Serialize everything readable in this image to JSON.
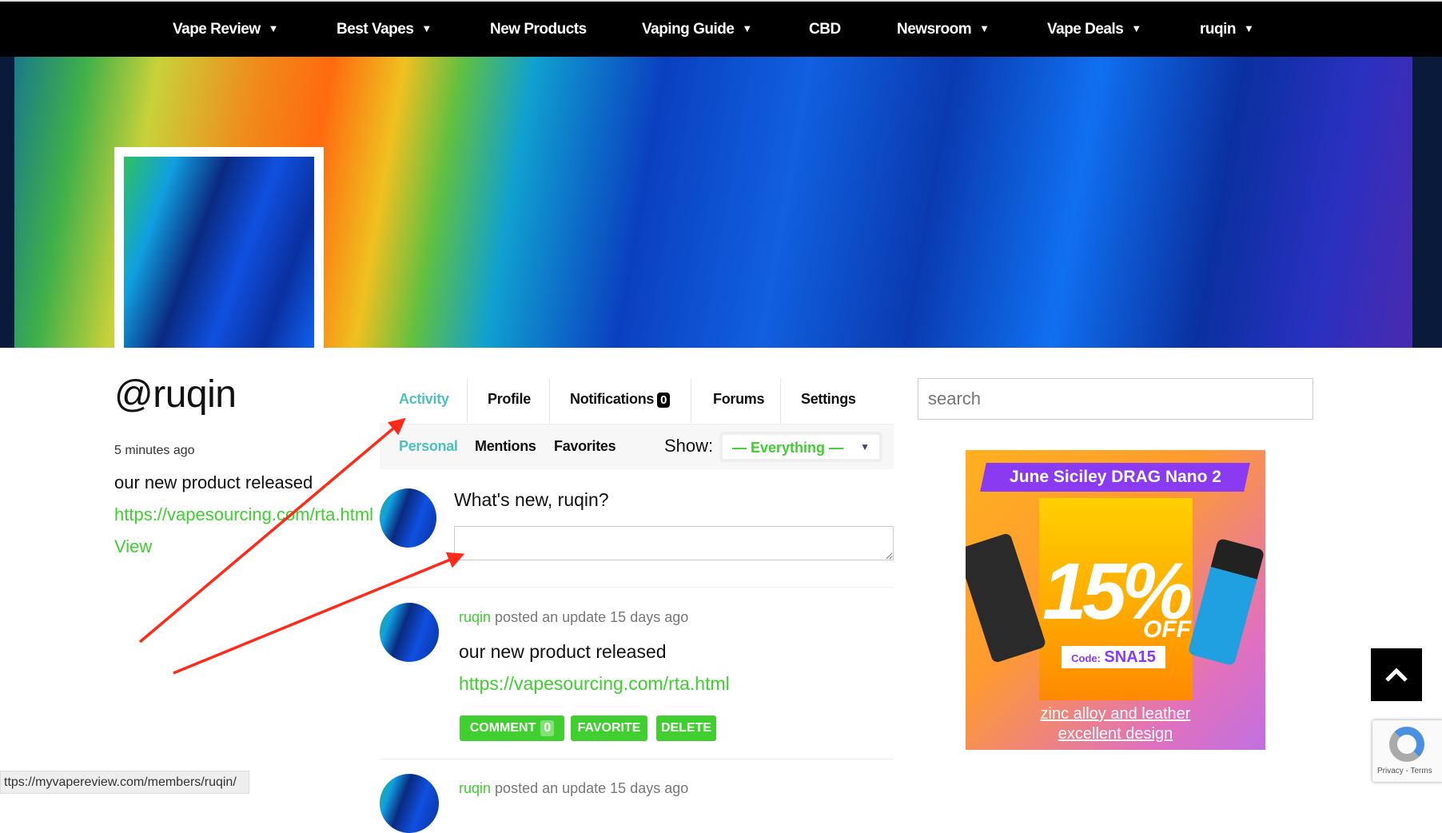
{
  "nav": {
    "items": [
      {
        "label": "Vape Review",
        "dropdown": true
      },
      {
        "label": "Best Vapes",
        "dropdown": true
      },
      {
        "label": "New Products",
        "dropdown": false
      },
      {
        "label": "Vaping Guide",
        "dropdown": true
      },
      {
        "label": "CBD",
        "dropdown": false
      },
      {
        "label": "Newsroom",
        "dropdown": true
      },
      {
        "label": "Vape Deals",
        "dropdown": true
      },
      {
        "label": "ruqin",
        "dropdown": true
      }
    ]
  },
  "profile": {
    "username": "@ruqin",
    "last_active": "5 minutes ago",
    "latest_update": "our new product released",
    "latest_link": "https://vapesourcing.com/rta.html",
    "view_link": "View"
  },
  "tabs": {
    "activity": "Activity",
    "profile": "Profile",
    "notifications": "Notifications",
    "notifications_count": "0",
    "forums": "Forums",
    "settings": "Settings"
  },
  "subnav": {
    "personal": "Personal",
    "mentions": "Mentions",
    "favorites": "Favorites",
    "show_label": "Show:",
    "show_value": "— Everything —"
  },
  "post_form": {
    "prompt": "What's new, ruqin?",
    "value": ""
  },
  "activity": [
    {
      "user": "ruqin",
      "action": "posted an update 15 days ago",
      "text": "our new product released",
      "link": "https://vapesourcing.com/rta.html",
      "comment": "COMMENT",
      "comment_count": "0",
      "favorite": "FAVORITE",
      "delete": "DELETE"
    },
    {
      "user": "ruqin",
      "action": "posted an update 15 days ago"
    }
  ],
  "search": {
    "placeholder": "search"
  },
  "ad": {
    "title": "June Siciley DRAG Nano 2",
    "discount": "15%",
    "off": "OFF",
    "code_label": "Code:",
    "code": "SNA15",
    "line1": "zinc alloy and leather",
    "line2": "excellent design"
  },
  "recaptcha": {
    "text": "Privacy - Terms"
  },
  "status_bar": {
    "url": "ttps://myvapereview.com/members/ruqin/"
  },
  "colors": {
    "accent_green": "#3fcf2f",
    "active_tab": "#4fbfbf",
    "nav_bg": "#000000",
    "annotation_arrow": "#ff2a1a"
  }
}
